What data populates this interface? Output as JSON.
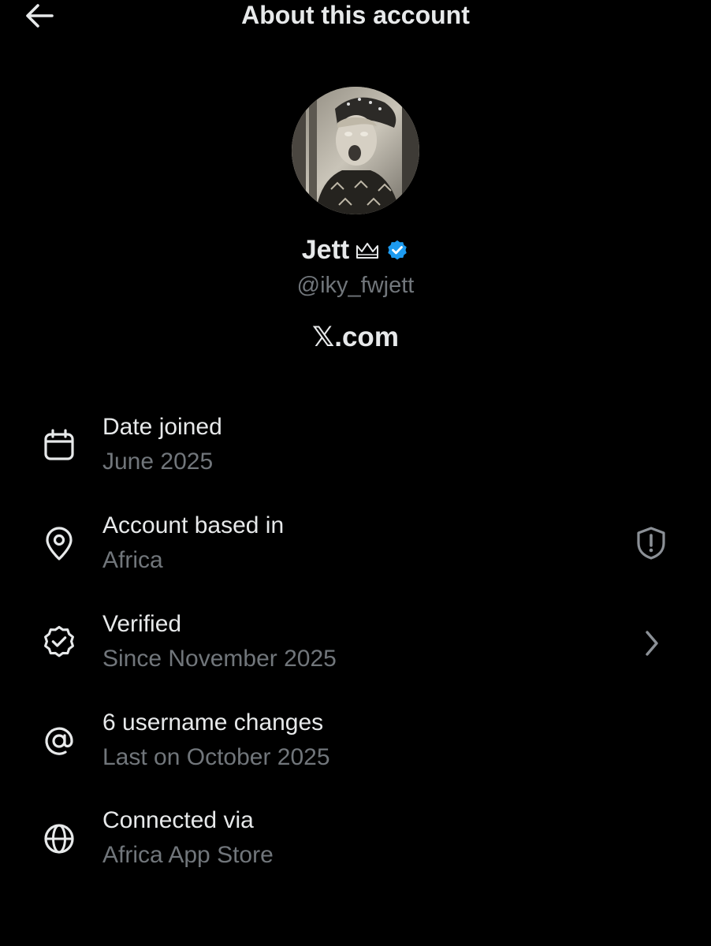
{
  "header": {
    "title": "About this account",
    "back_icon": "arrow-left-icon"
  },
  "profile": {
    "display_name": "Jett",
    "name_emoji": "crown-icon",
    "verified_badge": "verified-check-icon",
    "badge_color": "#1d9bf0",
    "handle": "@iky_fwjett",
    "site": "𝕏.com"
  },
  "info": [
    {
      "icon": "calendar-icon",
      "label": "Date joined",
      "value": "June 2025"
    },
    {
      "icon": "location-pin-icon",
      "label": "Account based in",
      "value": "Africa",
      "trailing_icon": "shield-alert-icon"
    },
    {
      "icon": "verified-badge-icon",
      "label": "Verified",
      "value": "Since November 2025",
      "trailing_icon": "chevron-right-icon"
    },
    {
      "icon": "at-sign-icon",
      "label": "6 username changes",
      "value": "Last on October 2025"
    },
    {
      "icon": "globe-icon",
      "label": "Connected via",
      "value": "Africa App Store"
    }
  ],
  "colors": {
    "background": "#000000",
    "primary_text": "#e7e9ea",
    "secondary_text": "#71767b",
    "accent": "#1d9bf0"
  }
}
